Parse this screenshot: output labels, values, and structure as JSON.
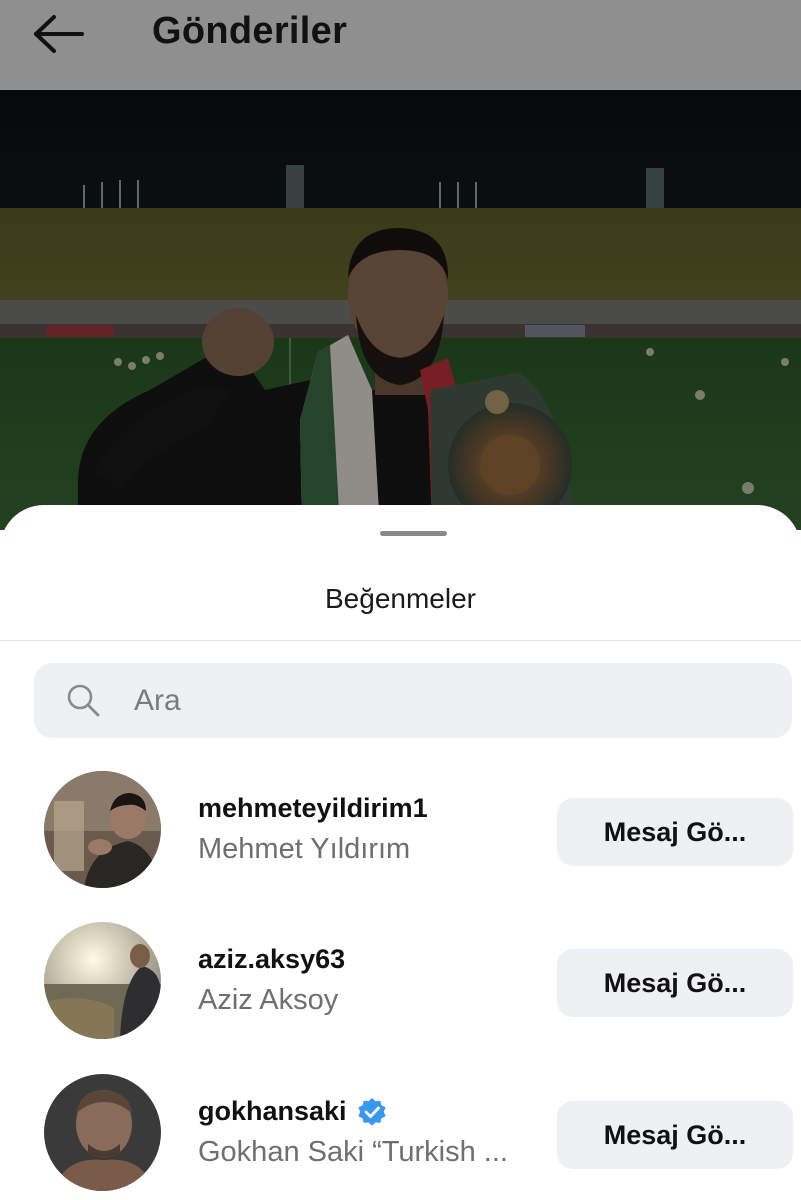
{
  "header": {
    "title": "Gönderiler",
    "back_icon": "arrow-left-icon"
  },
  "post": {
    "image": "post-photo-stadium"
  },
  "likes_sheet": {
    "title": "Beğenmeler",
    "search": {
      "placeholder": "Ara",
      "icon": "search-icon"
    },
    "users": [
      {
        "username": "mehmeteyildirim1",
        "full_name": "Mehmet Yıldırım",
        "verified": false,
        "button_label": "Mesaj Gö..."
      },
      {
        "username": "aziz.aksy63",
        "full_name": "Aziz Aksoy",
        "verified": false,
        "button_label": "Mesaj Gö..."
      },
      {
        "username": "gokhansaki",
        "full_name": "Gokhan Saki “Turkish ...",
        "verified": true,
        "button_label": "Mesaj Gö..."
      }
    ]
  },
  "colors": {
    "overlay": "#8f8f8f",
    "sheet_bg": "#ffffff",
    "field_bg": "#eff0f4",
    "secondary_text": "#6e6e73",
    "verified": "#3897f0"
  }
}
